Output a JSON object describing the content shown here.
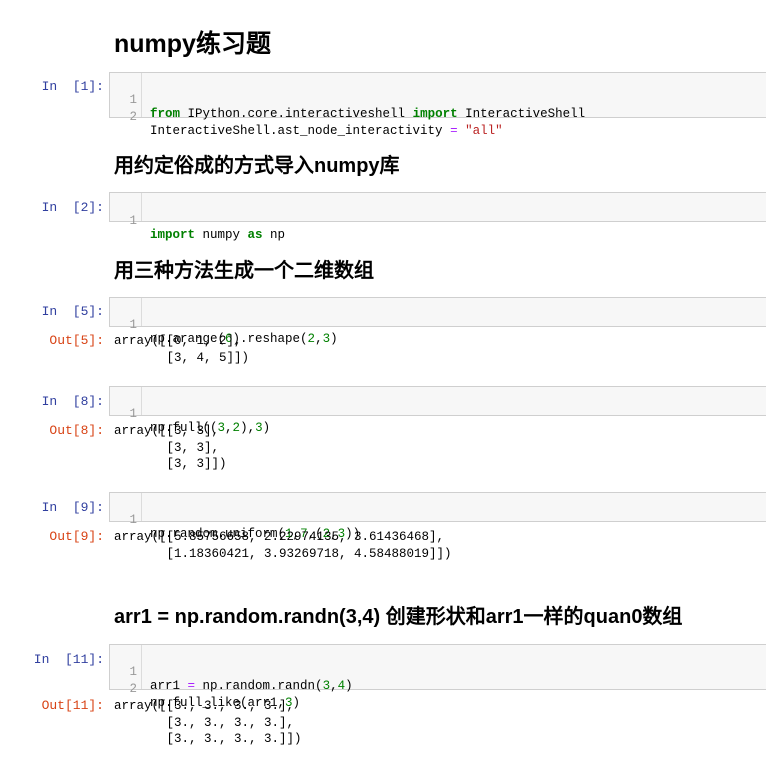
{
  "headings": {
    "title": "numpy练习题",
    "import_heading": "用约定俗成的方式导入numpy库",
    "create_heading": "用三种方法生成一个二维数组",
    "randn_heading": "arr1 = np.random.randn(3,4) 创建形状和arr1一样的quan0数组"
  },
  "cells": [
    {
      "in_prompt": "In  [1]:",
      "lines": [
        {
          "n": "1",
          "tokens": [
            {
              "t": "kw",
              "v": "from"
            },
            {
              "t": "",
              "v": " IPython.core.interactiveshell "
            },
            {
              "t": "kw",
              "v": "import"
            },
            {
              "t": "",
              "v": " InteractiveShell"
            }
          ]
        },
        {
          "n": "2",
          "tokens": [
            {
              "t": "",
              "v": "InteractiveShell.ast_node_interactivity "
            },
            {
              "t": "op",
              "v": "="
            },
            {
              "t": "",
              "v": " "
            },
            {
              "t": "str",
              "v": "\"all\""
            }
          ]
        }
      ]
    },
    {
      "in_prompt": "In  [2]:",
      "lines": [
        {
          "n": "1",
          "tokens": [
            {
              "t": "kw",
              "v": "import"
            },
            {
              "t": "",
              "v": " numpy "
            },
            {
              "t": "kw",
              "v": "as"
            },
            {
              "t": "",
              "v": " np"
            }
          ]
        }
      ]
    },
    {
      "in_prompt": "In  [5]:",
      "lines": [
        {
          "n": "1",
          "tokens": [
            {
              "t": "",
              "v": "np.arange("
            },
            {
              "t": "num",
              "v": "6"
            },
            {
              "t": "",
              "v": ").reshape("
            },
            {
              "t": "num",
              "v": "2"
            },
            {
              "t": "",
              "v": ","
            },
            {
              "t": "num",
              "v": "3"
            },
            {
              "t": "",
              "v": ")"
            }
          ]
        }
      ],
      "out_prompt": "Out[5]:",
      "output": "array([[0, 1, 2],\n       [3, 4, 5]])"
    },
    {
      "in_prompt": "In  [8]:",
      "lines": [
        {
          "n": "1",
          "tokens": [
            {
              "t": "",
              "v": "np.full(("
            },
            {
              "t": "num",
              "v": "3"
            },
            {
              "t": "",
              "v": ","
            },
            {
              "t": "num",
              "v": "2"
            },
            {
              "t": "",
              "v": "),"
            },
            {
              "t": "num",
              "v": "3"
            },
            {
              "t": "",
              "v": ")"
            }
          ]
        }
      ],
      "out_prompt": "Out[8]:",
      "output": "array([[3, 3],\n       [3, 3],\n       [3, 3]])"
    },
    {
      "in_prompt": "In  [9]:",
      "lines": [
        {
          "n": "1",
          "tokens": [
            {
              "t": "",
              "v": "np.random.uniform("
            },
            {
              "t": "num",
              "v": "1"
            },
            {
              "t": "",
              "v": ","
            },
            {
              "t": "num",
              "v": "7"
            },
            {
              "t": "",
              "v": ",("
            },
            {
              "t": "num",
              "v": "2"
            },
            {
              "t": "",
              "v": ","
            },
            {
              "t": "num",
              "v": "3"
            },
            {
              "t": "",
              "v": "))"
            }
          ]
        }
      ],
      "out_prompt": "Out[9]:",
      "output": "array([[5.85756658, 2.22974135, 3.61436468],\n       [1.18360421, 3.93269718, 4.58488019]])"
    },
    {
      "in_prompt": "In  [11]:",
      "lines": [
        {
          "n": "1",
          "tokens": [
            {
              "t": "",
              "v": "arr1 "
            },
            {
              "t": "op",
              "v": "="
            },
            {
              "t": "",
              "v": " np.random.randn("
            },
            {
              "t": "num",
              "v": "3"
            },
            {
              "t": "",
              "v": ","
            },
            {
              "t": "num",
              "v": "4"
            },
            {
              "t": "",
              "v": ")"
            }
          ]
        },
        {
          "n": "2",
          "tokens": [
            {
              "t": "",
              "v": "np.full_like(arr1,"
            },
            {
              "t": "num",
              "v": "3"
            },
            {
              "t": "",
              "v": ")"
            }
          ]
        }
      ],
      "out_prompt": "Out[11]:",
      "output": "array([[3., 3., 3., 3.],\n       [3., 3., 3., 3.],\n       [3., 3., 3., 3.]])"
    }
  ]
}
